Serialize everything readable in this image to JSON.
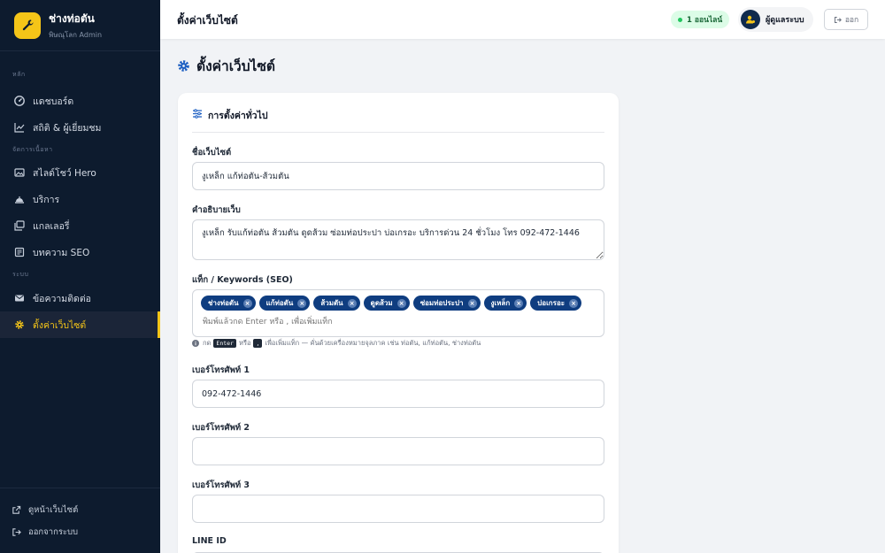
{
  "brand": {
    "name": "ช่างท่อตัน",
    "subtitle": "พิษณุโลก Admin"
  },
  "sidebar": {
    "sections": [
      {
        "title": "หลัก",
        "items": [
          {
            "label": "แดชบอร์ด",
            "icon": "dashboard-icon"
          },
          {
            "label": "สถิติ & ผู้เยี่ยมชม",
            "icon": "chart-line-icon"
          }
        ]
      },
      {
        "title": "จัดการเนื้อหา",
        "items": [
          {
            "label": "สไลด์โชว์ Hero",
            "icon": "images-icon"
          },
          {
            "label": "บริการ",
            "icon": "service-icon"
          },
          {
            "label": "แกลเลอรี่",
            "icon": "gallery-icon"
          },
          {
            "label": "บทความ SEO",
            "icon": "article-icon"
          }
        ]
      },
      {
        "title": "ระบบ",
        "items": [
          {
            "label": "ข้อความติดต่อ",
            "icon": "envelope-icon"
          },
          {
            "label": "ตั้งค่าเว็บไซต์",
            "icon": "gear-icon",
            "active": true
          }
        ]
      }
    ],
    "bottom": [
      {
        "label": "ดูหน้าเว็บไซต์",
        "icon": "external-link-icon"
      },
      {
        "label": "ออกจากระบบ",
        "icon": "sign-out-icon"
      }
    ]
  },
  "header": {
    "title": "ตั้งค่าเว็บไซต์",
    "online_badge": "1 ออนไลน์",
    "user_name": "ผู้ดูแลระบบ",
    "logout_label": "ออก"
  },
  "page": {
    "title": "ตั้งค่าเว็บไซต์",
    "section_title": "การตั้งค่าทั่วไป",
    "fields": {
      "site_name": {
        "label": "ชื่อเว็บไซต์",
        "value": "งูเหล็ก แก้ท่อตัน-ส้วมตัน"
      },
      "site_description": {
        "label": "คำอธิบายเว็บ",
        "value": "งูเหล็ก รับแก้ท่อตัน ส้วมตัน ดูดส้วม ซ่อมท่อประปา บ่อเกรอะ บริการด่วน 24 ชั่วโมง โทร 092-472-1446"
      },
      "keywords": {
        "label": "แท็ก / Keywords (SEO)",
        "tags": [
          "ช่างท่อตัน",
          "แก้ท่อตัน",
          "ส้วมตัน",
          "ดูดส้วม",
          "ซ่อมท่อประปา",
          "งูเหล็ก",
          "บ่อเกรอะ"
        ],
        "placeholder": "พิมพ์แล้วกด Enter หรือ , เพื่อเพิ่มแท็ก",
        "hint_prefix": "กด",
        "hint_key1": "Enter",
        "hint_or": "หรือ",
        "hint_key2": ",",
        "hint_suffix": "เพื่อเพิ่มแท็ก — คั่นด้วยเครื่องหมายจุลภาค เช่น ท่อตัน, แก้ท่อตัน, ช่างท่อตัน"
      },
      "phone1": {
        "label": "เบอร์โทรศัพท์ 1",
        "value": "092-472-1446"
      },
      "phone2": {
        "label": "เบอร์โทรศัพท์ 2",
        "value": ""
      },
      "phone3": {
        "label": "เบอร์โทรศัพท์ 3",
        "value": ""
      },
      "line_id": {
        "label": "LINE ID",
        "value": ""
      }
    }
  },
  "colors": {
    "sidebar_bg": "#0d1b2e",
    "accent": "#f5c518",
    "tag_bg": "#0f3d80",
    "page_bg": "#f1f3f6"
  }
}
